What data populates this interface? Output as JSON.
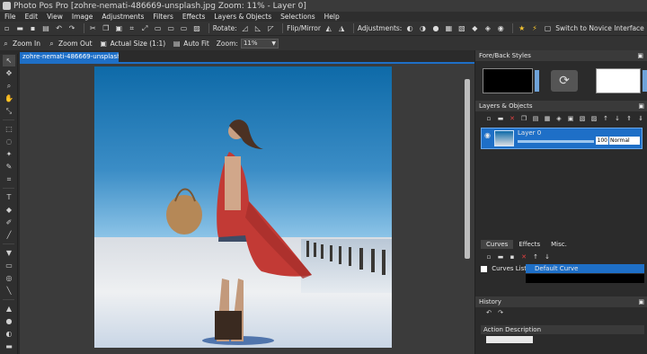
{
  "window": {
    "title": "Photo Pos Pro [zohre-nemati-486669-unsplash.jpg Zoom: 11% - Layer 0]"
  },
  "menu": [
    "File",
    "Edit",
    "View",
    "Image",
    "Adjustments",
    "Filters",
    "Effects",
    "Layers & Objects",
    "Selections",
    "Help"
  ],
  "toolbar": {
    "rotate_label": "Rotate:",
    "flip_label": "Flip/Mirror",
    "adjustments_label": "Adjustments:",
    "novice_label": "Switch to Novice Interface"
  },
  "zoombar": {
    "zoom_in": "Zoom In",
    "zoom_out": "Zoom Out",
    "actual_size": "Actual Size (1:1)",
    "auto_fit": "Auto Fit",
    "zoom_label": "Zoom:",
    "zoom_value": "11%"
  },
  "document": {
    "tab_label": "zohre-nemati-486669-unsplash.jpg"
  },
  "panels": {
    "fore_back": {
      "title": "Fore/Back Styles"
    },
    "layers": {
      "title": "Layers & Objects",
      "layer_name": "Layer 0",
      "opacity": "100",
      "blend_mode": "Normal"
    },
    "tabs": [
      "Curves",
      "Effects",
      "Misc."
    ],
    "curves": {
      "list_label": "Curves List:",
      "selected": "Default Curve"
    },
    "history": {
      "title": "History",
      "column": "Action Description"
    }
  },
  "colors": {
    "accent": "#1e6fc7",
    "background": "#2b2b2b"
  }
}
